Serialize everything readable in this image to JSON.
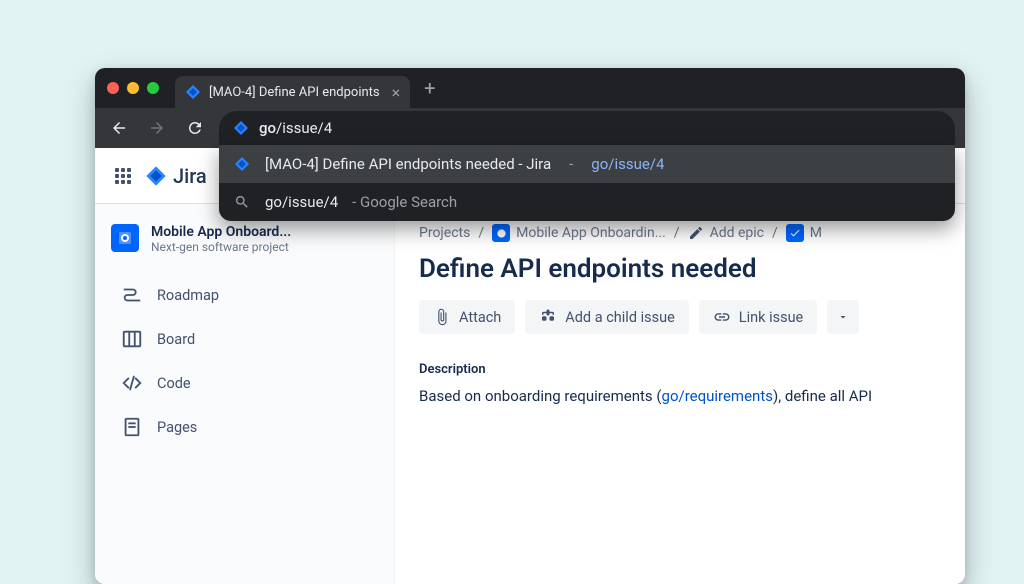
{
  "browser": {
    "tab_title": "[MAO-4] Define API endpoints",
    "url_typed": "go/issue/4",
    "url_prefix": "go",
    "url_path": "/issue/4",
    "suggestions": [
      {
        "title": "[MAO-4] Define API endpoints needed - Jira",
        "url": "go/issue/4"
      },
      {
        "query": "go/issue/4",
        "engine": "Google Search"
      }
    ]
  },
  "jira": {
    "product_name": "Jira",
    "project": {
      "name": "Mobile App Onboard...",
      "subtitle": "Next-gen software project"
    },
    "sidebar": {
      "items": [
        {
          "label": "Roadmap"
        },
        {
          "label": "Board"
        },
        {
          "label": "Code"
        },
        {
          "label": "Pages"
        }
      ]
    },
    "breadcrumb": {
      "root": "Projects",
      "project": "Mobile App Onboardin...",
      "epic": "Add epic",
      "issue_truncated": "M"
    },
    "issue": {
      "title": "Define API endpoints needed",
      "actions": {
        "attach": "Attach",
        "child": "Add a child issue",
        "link": "Link issue"
      },
      "description_label": "Description",
      "description_before": "Based on onboarding requirements (",
      "description_link": "go/requirements",
      "description_after": "), define all API "
    }
  }
}
